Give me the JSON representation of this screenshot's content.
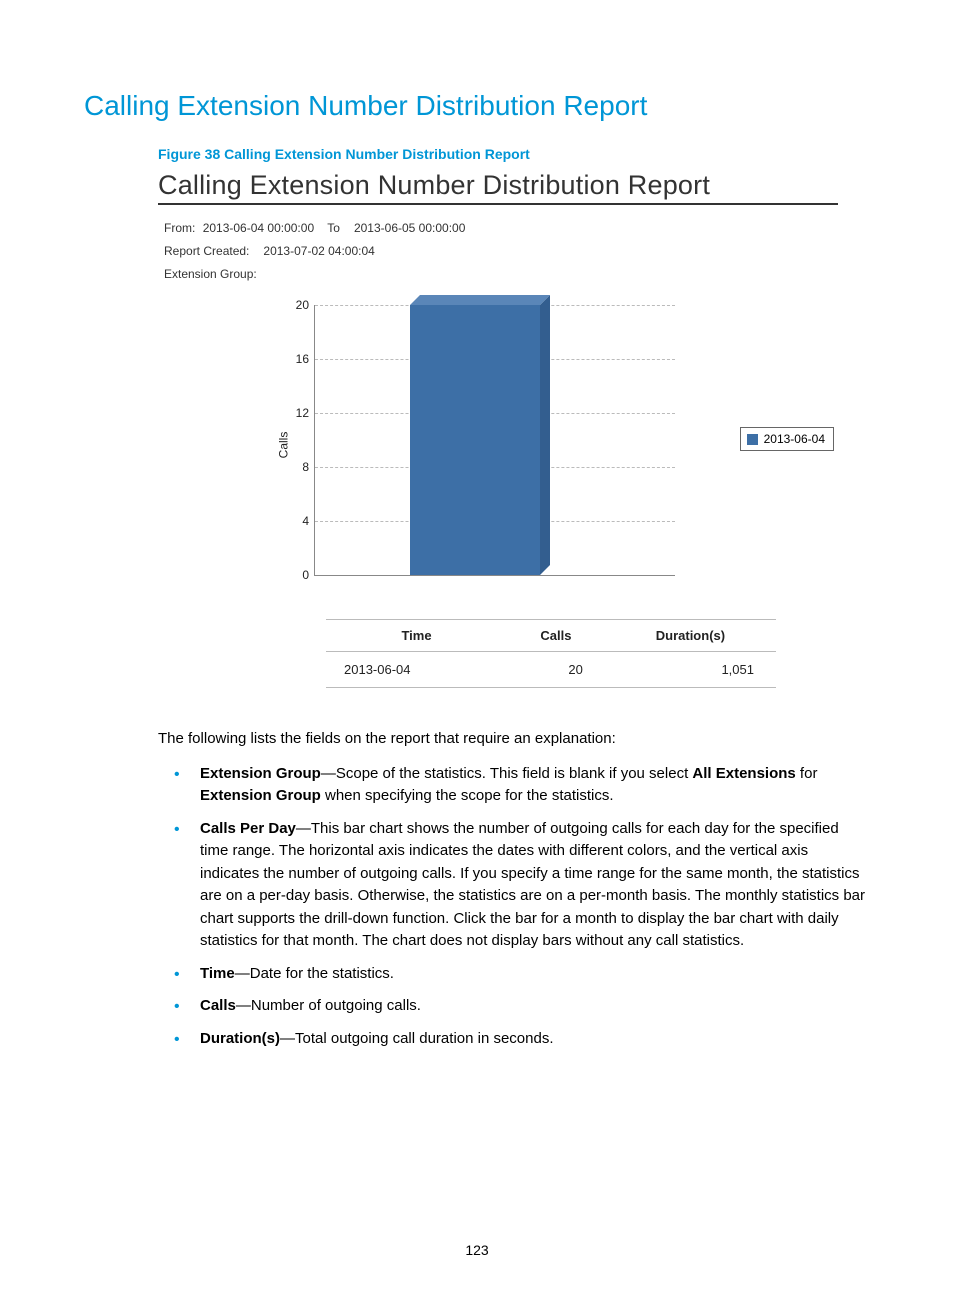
{
  "page": {
    "title": "Calling Extension Number Distribution Report",
    "figure_caption": "Figure 38 Calling Extension Number Distribution Report",
    "page_number": "123"
  },
  "report": {
    "title": "Calling Extension Number Distribution Report",
    "from_label": "From:",
    "from_value": "2013-06-04 00:00:00",
    "to_label": "To",
    "to_value": "2013-06-05 00:00:00",
    "created_label": "Report  Created:",
    "created_value": "2013-07-02 04:00:04",
    "ext_group_label": "Extension Group:",
    "ext_group_value": ""
  },
  "chart_data": {
    "type": "bar",
    "ylabel": "Calls",
    "ylim": [
      0,
      20
    ],
    "yticks": [
      0,
      4,
      8,
      12,
      16,
      20
    ],
    "categories": [
      "2013-06-04"
    ],
    "series": [
      {
        "name": "2013-06-04",
        "values": [
          20
        ],
        "color": "#3d6fa6"
      }
    ],
    "legend": [
      "2013-06-04"
    ]
  },
  "table": {
    "headers": [
      "Time",
      "Calls",
      "Duration(s)"
    ],
    "rows": [
      {
        "time": "2013-06-04",
        "calls": "20",
        "duration": "1,051"
      }
    ]
  },
  "body": {
    "intro": "The following lists the fields on the report that require an explanation:",
    "items": [
      {
        "term": "Extension Group",
        "text_before": "—Scope of the statistics. This field is blank if you select ",
        "bold1": "All Extensions",
        "text_mid": " for ",
        "bold2": "Extension Group",
        "text_after": " when specifying the scope for the statistics."
      },
      {
        "term": "Calls Per Day",
        "text": "—This bar chart shows the number of outgoing calls for each day for the specified time range. The horizontal axis indicates the dates with different colors, and the vertical axis indicates the number of outgoing calls. If you specify a time range for the same month, the statistics are on a per-day basis. Otherwise, the statistics are on a per-month basis. The monthly statistics bar chart supports the drill-down function. Click the bar for a month to display the bar chart with daily statistics for that month. The chart does not display bars without any call statistics."
      },
      {
        "term": "Time",
        "text": "—Date for the statistics."
      },
      {
        "term": "Calls",
        "text": "—Number of outgoing calls."
      },
      {
        "term": "Duration(s)",
        "text": "—Total outgoing call duration in seconds."
      }
    ]
  }
}
